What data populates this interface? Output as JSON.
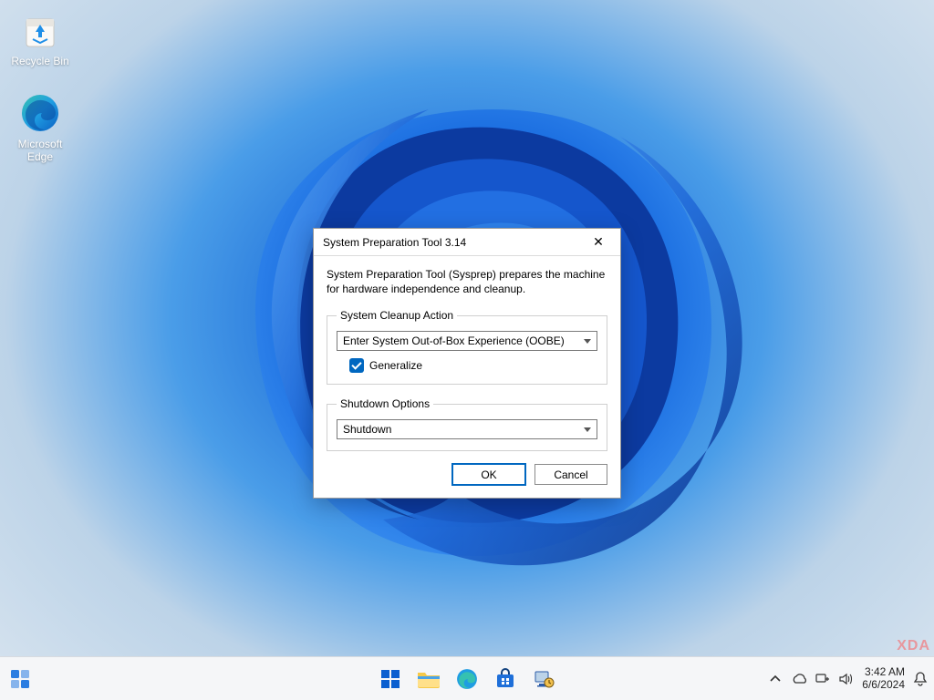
{
  "desktop": {
    "icons": [
      {
        "name": "recycle-bin",
        "label": "Recycle Bin"
      },
      {
        "name": "microsoft-edge",
        "label": "Microsoft\nEdge"
      }
    ]
  },
  "dialog": {
    "title": "System Preparation Tool 3.14",
    "description": "System Preparation Tool (Sysprep) prepares the machine for hardware independence and cleanup.",
    "cleanup": {
      "legend": "System Cleanup Action",
      "selected": "Enter System Out-of-Box Experience (OOBE)",
      "generalize_label": "Generalize",
      "generalize_checked": true
    },
    "shutdown": {
      "legend": "Shutdown Options",
      "selected": "Shutdown"
    },
    "buttons": {
      "ok": "OK",
      "cancel": "Cancel"
    }
  },
  "taskbar": {
    "time": "3:42 AM",
    "date": "6/6/2024"
  },
  "watermark": "XDA"
}
